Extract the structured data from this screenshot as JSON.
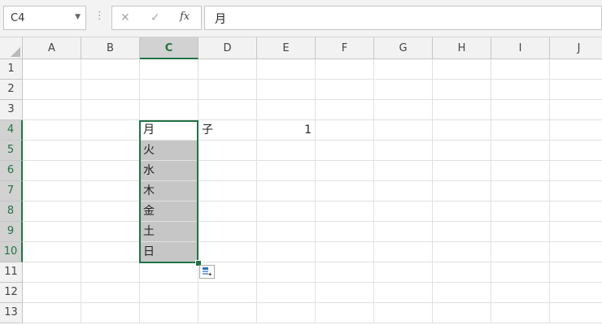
{
  "formula_bar": {
    "name_box": "C4",
    "cancel_icon": "✕",
    "enter_icon": "✓",
    "fx_label": "fx",
    "formula": "月"
  },
  "columns": [
    "A",
    "B",
    "C",
    "D",
    "E",
    "F",
    "G",
    "H",
    "I",
    "J"
  ],
  "rows": [
    "1",
    "2",
    "3",
    "4",
    "5",
    "6",
    "7",
    "8",
    "9",
    "10",
    "11",
    "12",
    "13"
  ],
  "cells": {
    "C4": "月",
    "D4": "子",
    "E4": "1",
    "C5": "火",
    "C6": "水",
    "C7": "木",
    "C8": "金",
    "C9": "土",
    "C10": "日"
  },
  "selection": {
    "active_cell": "C4",
    "range": "C4:C10"
  },
  "colors": {
    "accent": "#217346",
    "selection_fill": "#c6c6c6"
  },
  "icons": {
    "autofill_options": "autofill-options-icon",
    "name_box_dropdown": "chevron-down-icon"
  }
}
